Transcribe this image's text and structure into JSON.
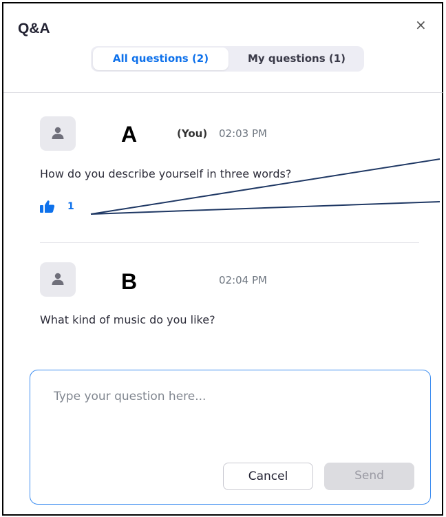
{
  "panel": {
    "title": "Q&A",
    "close_symbol": "×"
  },
  "tabs": [
    {
      "label": "All questions (2)",
      "active": true
    },
    {
      "label": "My questions (1)",
      "active": false
    }
  ],
  "questions": [
    {
      "author": "A",
      "you_tag": "(You)",
      "time": "02:03 PM",
      "text": "How do you describe yourself in three words?",
      "likes": "1",
      "icon": "thumbs-up-icon"
    },
    {
      "author": "B",
      "time": "02:04 PM",
      "text": "What kind of music do you like?"
    }
  ],
  "compose": {
    "placeholder": "Type your question here...",
    "cancel_label": "Cancel",
    "send_label": "Send"
  },
  "colors": {
    "accent": "#0e71eb",
    "annotation_line": "#1f3864"
  }
}
